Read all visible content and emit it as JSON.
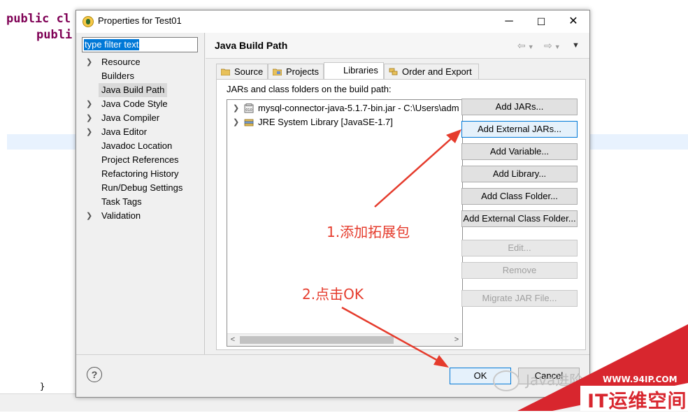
{
  "editor": {
    "code_lines": [
      "public cl",
      "publi",
      "}"
    ],
    "colors": {
      "keyword": "#7f0055",
      "highlight": "#e8f2fe"
    }
  },
  "dialog": {
    "title": "Properties for Test01",
    "window_buttons": {
      "minimize": "─",
      "maximize": "☐",
      "close": "✕"
    },
    "filter": {
      "value": "type filter text"
    },
    "nav_items": [
      {
        "label": "Resource",
        "expandable": true,
        "selected": false
      },
      {
        "label": "Builders",
        "expandable": false,
        "selected": false
      },
      {
        "label": "Java Build Path",
        "expandable": false,
        "selected": true
      },
      {
        "label": "Java Code Style",
        "expandable": true,
        "selected": false
      },
      {
        "label": "Java Compiler",
        "expandable": true,
        "selected": false
      },
      {
        "label": "Java Editor",
        "expandable": true,
        "selected": false
      },
      {
        "label": "Javadoc Location",
        "expandable": false,
        "selected": false
      },
      {
        "label": "Project References",
        "expandable": false,
        "selected": false
      },
      {
        "label": "Refactoring History",
        "expandable": false,
        "selected": false
      },
      {
        "label": "Run/Debug Settings",
        "expandable": false,
        "selected": false
      },
      {
        "label": "Task Tags",
        "expandable": false,
        "selected": false
      },
      {
        "label": "Validation",
        "expandable": true,
        "selected": false
      }
    ],
    "page_title": "Java Build Path",
    "tabs": [
      {
        "label": "Source",
        "icon": "source-folder-icon",
        "active": false
      },
      {
        "label": "Projects",
        "icon": "projects-icon",
        "active": false
      },
      {
        "label": "Libraries",
        "icon": "",
        "active": true
      },
      {
        "label": "Order and Export",
        "icon": "order-export-icon",
        "active": false
      }
    ],
    "libraries": {
      "caption": "JARs and class folders on the build path:",
      "entries": [
        {
          "label": "mysql-connector-java-5.1.7-bin.jar - C:\\Users\\adm",
          "icon": "jar-icon"
        },
        {
          "label": "JRE System Library [JavaSE-1.7]",
          "icon": "library-icon"
        }
      ],
      "buttons": [
        {
          "label": "Add JARs...",
          "enabled": true,
          "focused": false
        },
        {
          "label": "Add External JARs...",
          "enabled": true,
          "focused": true
        },
        {
          "label": "Add Variable...",
          "enabled": true,
          "focused": false
        },
        {
          "label": "Add Library...",
          "enabled": true,
          "focused": false
        },
        {
          "label": "Add Class Folder...",
          "enabled": true,
          "focused": false
        },
        {
          "label": "Add External Class Folder...",
          "enabled": true,
          "focused": false
        },
        {
          "label": "Edit...",
          "enabled": false,
          "focused": false
        },
        {
          "label": "Remove",
          "enabled": false,
          "focused": false
        },
        {
          "label": "Migrate JAR File...",
          "enabled": false,
          "focused": false
        }
      ]
    },
    "footer": {
      "help": "?",
      "ok": "OK",
      "cancel": "Cancel"
    },
    "colors": {
      "focus_border": "#0078d7",
      "selection": "#0078d7"
    }
  },
  "annotations": {
    "step1": "1.添加拓展包",
    "step2": "2.点击OK",
    "color": "#e53b2c"
  },
  "watermark": {
    "wechat": "Java进阶",
    "site_url": "WWW.94IP.COM",
    "site_brand": "IT运维空间",
    "brand_color": "#d8262e"
  }
}
